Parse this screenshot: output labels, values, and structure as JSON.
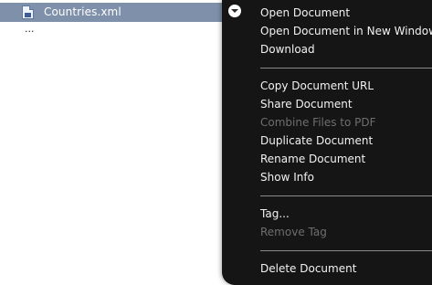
{
  "file": {
    "name": "Countries.xml",
    "more": "..."
  },
  "icons": {
    "file": "xml-file-icon",
    "trigger": "chevron-down-icon"
  },
  "menu": {
    "group1": [
      {
        "label": "Open Document",
        "disabled": false
      },
      {
        "label": "Open Document in New Window",
        "disabled": false
      },
      {
        "label": "Download",
        "disabled": false
      }
    ],
    "group2": [
      {
        "label": "Copy Document URL",
        "disabled": false
      },
      {
        "label": "Share Document",
        "disabled": false
      },
      {
        "label": "Combine Files to PDF",
        "disabled": true
      },
      {
        "label": "Duplicate Document",
        "disabled": false
      },
      {
        "label": "Rename Document",
        "disabled": false
      },
      {
        "label": "Show Info",
        "disabled": false
      }
    ],
    "group3": [
      {
        "label": "Tag...",
        "disabled": false
      },
      {
        "label": "Remove Tag",
        "disabled": true
      }
    ],
    "group4": [
      {
        "label": "Delete Document",
        "disabled": false
      }
    ]
  },
  "colors": {
    "selection": "#7f91aa",
    "menu_bg": "#151515",
    "menu_text": "#f2f2f2",
    "menu_disabled": "#6e6e6e"
  }
}
